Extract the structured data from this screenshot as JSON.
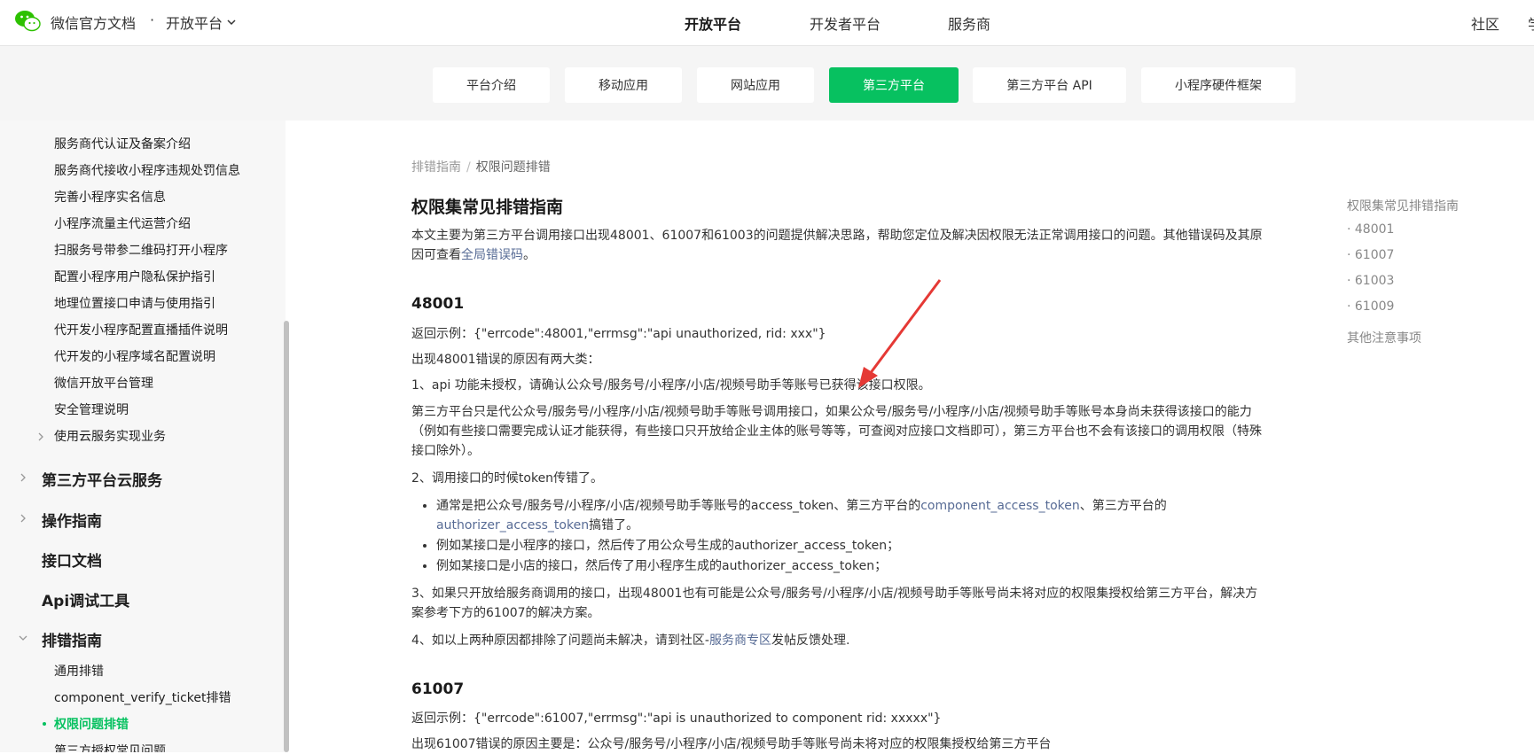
{
  "header": {
    "brand": "微信官方文档",
    "separator": "·",
    "platform_switch": "开放平台",
    "nav": [
      "开放平台",
      "开发者平台",
      "服务商"
    ],
    "community": "社区",
    "study": "学"
  },
  "subtabs": [
    "平台介绍",
    "移动应用",
    "网站应用",
    "第三方平台",
    "第三方平台 API",
    "小程序硬件框架"
  ],
  "sidebar": {
    "sub_items": [
      "服务商代认证及备案介绍",
      "服务商代接收小程序违规处罚信息",
      "完善小程序实名信息",
      "小程序流量主代运营介绍",
      "扫服务号带参二维码打开小程序",
      "配置小程序用户隐私保护指引",
      "地理位置接口申请与使用指引",
      "代开发小程序配置直播插件说明",
      "代开发的小程序域名配置说明",
      "微信开放平台管理",
      "安全管理说明",
      "使用云服务实现业务"
    ],
    "main_items": [
      "第三方平台云服务",
      "操作指南",
      "接口文档",
      "Api调试工具",
      "排错指南"
    ],
    "trouble_items": [
      "通用排错",
      "component_verify_ticket排错",
      "权限问题排错",
      "第三方授权常见问题"
    ]
  },
  "breadcrumb": {
    "parent": "排错指南",
    "sep": "/",
    "current": "权限问题排错"
  },
  "article": {
    "title": "权限集常见排错指南",
    "intro_a": "本文主要为第三方平台调用接口出现48001、61007和61003的问题提供解决思路，帮助您定位及解决因权限无法正常调用接口的问题。其他错误码及其原因可查看",
    "intro_link": "全局错误码",
    "intro_b": "。",
    "s1_title": "48001",
    "s1_example": "返回示例：{\"errcode\":48001,\"errmsg\":\"api unauthorized, rid: xxx\"}",
    "s1_reasons": "出现48001错误的原因有两大类：",
    "s1_r1": "1、api 功能未授权，请确认公众号/服务号/小程序/小店/视频号助手等账号已获得该接口权限。",
    "s1_r1_detail": "第三方平台只是代公众号/服务号/小程序/小店/视频号助手等账号调用接口，如果公众号/服务号/小程序/小店/视频号助手等账号本身尚未获得该接口的能力（例如有些接口需要完成认证才能获得，有些接口只开放给企业主体的账号等等，可查阅对应接口文档即可），第三方平台也不会有该接口的调用权限（特殊接口除外）。",
    "s1_r2": "2、调用接口的时候token传错了。",
    "b1_a": "通常是把公众号/服务号/小程序/小店/视频号助手等账号的access_token、第三方平台的",
    "b1_link1": "component_access_token",
    "b1_b": "、第三方平台的",
    "b1_link2": "authorizer_access_token",
    "b1_c": "搞错了。",
    "b2": "例如某接口是小程序的接口，然后传了用公众号生成的authorizer_access_token；",
    "b3": "例如某接口是小店的接口，然后传了用小程序生成的authorizer_access_token；",
    "s1_r3": "3、如果只开放给服务商调用的接口，出现48001也有可能是公众号/服务号/小程序/小店/视频号助手等账号尚未将对应的权限集授权给第三方平台，解决方案参考下方的61007的解决方案。",
    "s1_r4_a": "4、如以上两种原因都排除了问题尚未解决，请到社区-",
    "s1_r4_link": "服务商专区",
    "s1_r4_b": "发帖反馈处理.",
    "s2_title": "61007",
    "s2_example": "返回示例：{\"errcode\":61007,\"errmsg\":\"api is unauthorized to component rid: xxxxx\"}",
    "s2_reason": "出现61007错误的原因主要是：公众号/服务号/小程序/小店/视频号助手等账号尚未将对应的权限集授权给第三方平台"
  },
  "toc": {
    "title": "权限集常见排错指南",
    "items": [
      "· 48001",
      "· 61007",
      "· 61003",
      "· 61009"
    ],
    "other": "其他注意事项"
  },
  "colors": {
    "accent": "#07c160",
    "link": "#576b95",
    "annotation": "#e53935"
  }
}
